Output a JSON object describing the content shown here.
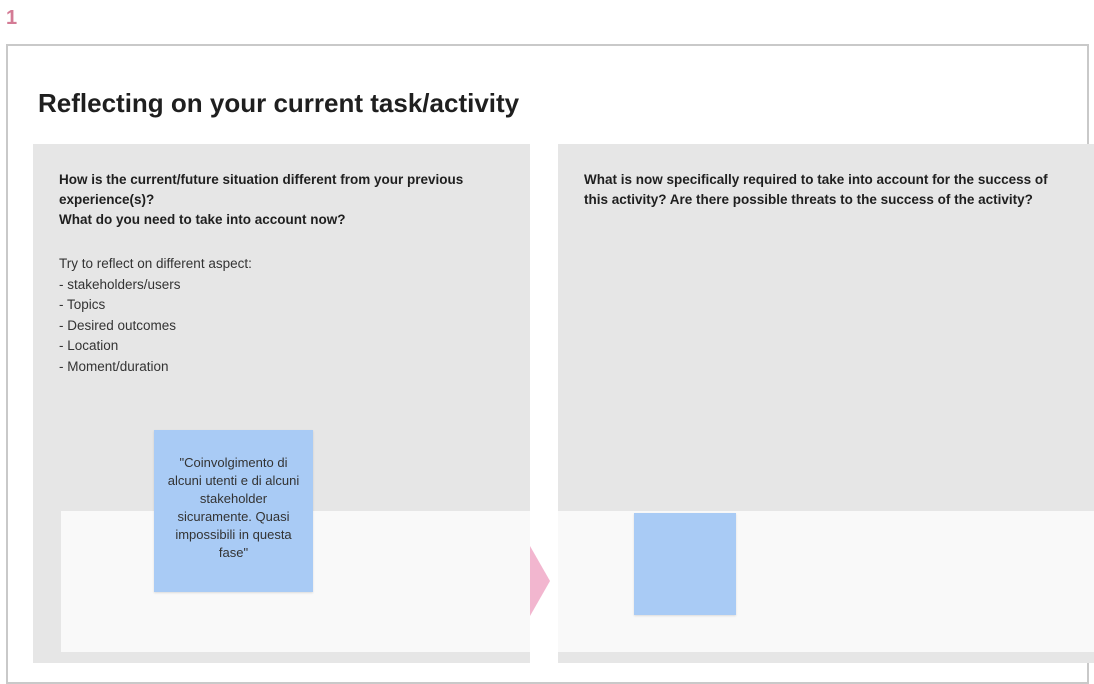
{
  "frame": {
    "number": "1",
    "title": "Reflecting on your current task/activity"
  },
  "left_panel": {
    "heading_lines": [
      "How is the current/future situation different from your previous experience(s)?",
      "What do you need to take into account now?"
    ],
    "body_intro": "Try to reflect on different aspect:",
    "aspects": [
      "- stakeholders/users",
      "- Topics",
      "- Desired outcomes",
      "- Location",
      "- Moment/duration"
    ]
  },
  "right_panel": {
    "heading": "What is now specifically required to take into account for the success of this activity? Are there possible threats to the success of the activity?"
  },
  "sticky_notes": [
    {
      "text": "\"Coinvolgimento di alcuni utenti e di alcuni stakeholder sicuramente. Quasi impossibili in questa fase\"",
      "color": "#a9cbf5"
    },
    {
      "text": "",
      "color": "#a9cbf5"
    }
  ],
  "colors": {
    "frame_number": "#d47b95",
    "panel_bg": "#e6e6e6",
    "drop_zone_bg": "#f9f9f9",
    "arrow": "#f2b6cf",
    "frame_border": "#c9c9c9"
  }
}
